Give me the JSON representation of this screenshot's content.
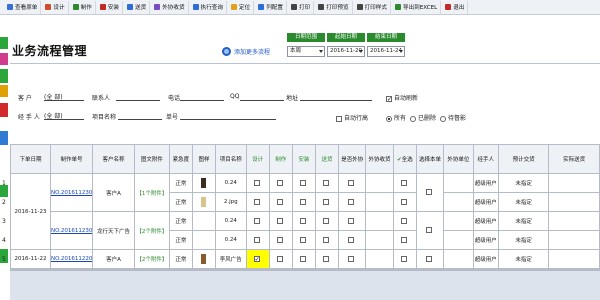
{
  "toolbar": {
    "items": [
      {
        "label": "查看原单",
        "icon": "doc-icon",
        "color": "#3a6fd8"
      },
      {
        "label": "设计",
        "icon": "design-icon",
        "color": "#d04d2a"
      },
      {
        "label": "制作",
        "icon": "make-icon",
        "color": "#2d8a2d"
      },
      {
        "label": "安装",
        "icon": "install-icon",
        "color": "#c22a2a"
      },
      {
        "label": "送货",
        "icon": "delivery-icon",
        "color": "#2e6cd6"
      },
      {
        "label": "外协收货",
        "icon": "receive-icon",
        "color": "#7a4cc2"
      },
      {
        "label": "执行查询",
        "icon": "search-icon",
        "color": "#2e6cd6"
      },
      {
        "label": "定位",
        "icon": "locate-icon",
        "color": "#e2a11a"
      },
      {
        "label": "列配置",
        "icon": "columns-icon",
        "color": "#2e6cd6"
      },
      {
        "label": "打印",
        "icon": "print-icon",
        "color": "#444444"
      },
      {
        "label": "打印预览",
        "icon": "print-preview-icon",
        "color": "#444444"
      },
      {
        "label": "打印样式",
        "icon": "print-style-icon",
        "color": "#444444"
      },
      {
        "label": "导出到EXCEL",
        "icon": "excel-icon",
        "color": "#2d8a2d"
      },
      {
        "label": "退出",
        "icon": "exit-icon",
        "color": "#c22a2a"
      }
    ]
  },
  "page": {
    "title": "业务流程管理",
    "add_flow_label": "添加更多流程"
  },
  "date_filter": {
    "tab_range": "日期范围",
    "tab_start": "起始日期",
    "tab_end": "结束日期",
    "range_value": "本周",
    "start_value": "2016-11-20",
    "end_value": "2016-11-24"
  },
  "filters": {
    "customer_label": "客 户",
    "customer_value": "(全 部)",
    "contact_label": "联系人",
    "phone_label": "电话",
    "qq_label": "QQ",
    "address_label": "地址",
    "auto_refresh_label": "自动刷新",
    "handler_label": "经 手 人",
    "handler_value": "(全 部)",
    "project_label": "项目名称",
    "order_label": "单号",
    "auto_newline_label": "自动行高",
    "radio_all": "所有",
    "radio_done": "已删除",
    "radio_pending": "待督影"
  },
  "table": {
    "headers": [
      "下单日期",
      "制作单号",
      "客户名称",
      "图文附件",
      "紧急度",
      "图样",
      "项目名称",
      "设计",
      "制作",
      "安装",
      "送货",
      "是否外协",
      "外协收货",
      "全选",
      "选择本单",
      "外协单位",
      "经手人",
      "预计交货",
      "实际送货"
    ],
    "rows": [
      {
        "idx": "1",
        "order_date": "2016-11-23",
        "order_no": "NO.20161123002",
        "customer": "客户A",
        "attach": "【1个附件】",
        "urgency": "正常",
        "project": "0.24",
        "handler": "超级用户",
        "delivery": "未指定"
      },
      {
        "idx": "2",
        "order_date": "",
        "order_no": "",
        "customer": "",
        "attach": "",
        "urgency": "正常",
        "project": "2.jpg",
        "handler": "超级用户",
        "delivery": "未指定"
      },
      {
        "idx": "3",
        "order_date": "",
        "order_no": "NO.20161123001",
        "customer": "龙行天下广告",
        "attach": "【2个附件】",
        "urgency": "正常",
        "project": "0.24",
        "handler": "超级用户",
        "delivery": "未指定"
      },
      {
        "idx": "4",
        "order_date": "",
        "order_no": "",
        "customer": "",
        "attach": "",
        "urgency": "正常",
        "project": "0.24",
        "handler": "超级用户",
        "delivery": "未指定"
      },
      {
        "idx": "5",
        "order_date": "2016-11-22",
        "order_no": "NO.20161122001",
        "customer": "客户A",
        "attach": "【2个附件】",
        "urgency": "正常",
        "project": "李风广告",
        "handler": "超级用户",
        "delivery": "未指定"
      }
    ]
  }
}
